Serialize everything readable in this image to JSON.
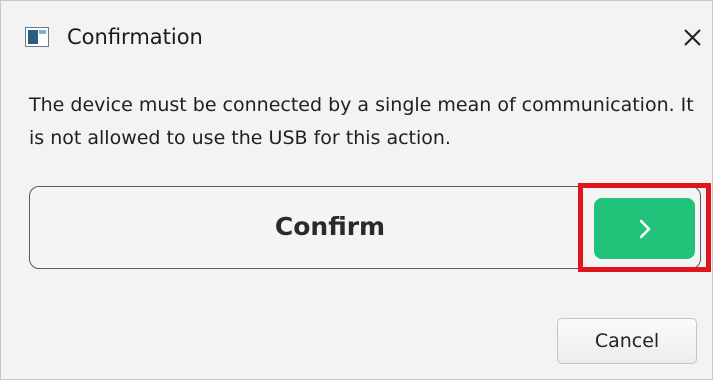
{
  "dialog": {
    "title": "Confirmation",
    "app_icon": "window-app-icon",
    "close_icon": "close-x-icon"
  },
  "message": "The device must be connected by a single mean of communication. It is not allowed to use the USB for this action.",
  "confirm_slider": {
    "label": "Confirm",
    "handle_icon": "chevron-right-icon",
    "handle_color": "#22c27a",
    "highlight_color": "#e0161e"
  },
  "buttons": {
    "cancel_label": "Cancel"
  }
}
